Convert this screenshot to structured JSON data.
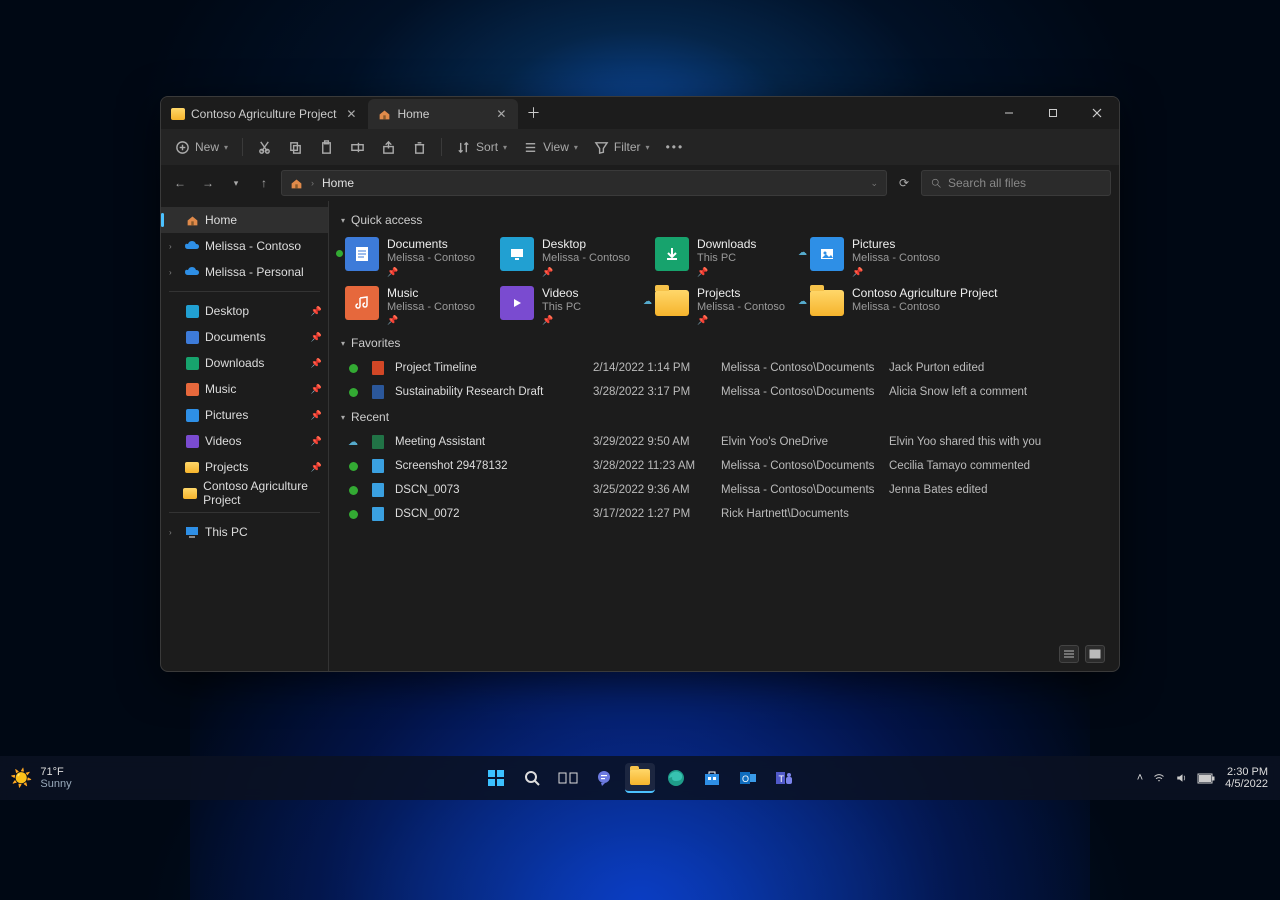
{
  "window": {
    "tabs": [
      {
        "label": "Contoso Agriculture Project",
        "icon": "folder"
      },
      {
        "label": "Home",
        "icon": "home"
      }
    ],
    "active_tab_index": 1
  },
  "toolbar": {
    "new_label": "New",
    "sort_label": "Sort",
    "view_label": "View",
    "filter_label": "Filter"
  },
  "address": {
    "segments": [
      "Home"
    ]
  },
  "search": {
    "placeholder": "Search all files"
  },
  "sidebar": {
    "top": [
      {
        "label": "Home",
        "icon": "home",
        "active": true
      },
      {
        "label": "Melissa - Contoso",
        "icon": "onedrive",
        "expandable": true
      },
      {
        "label": "Melissa - Personal",
        "icon": "onedrive",
        "expandable": true
      }
    ],
    "pinned": [
      {
        "label": "Desktop",
        "icon": "desktop",
        "pinned": true
      },
      {
        "label": "Documents",
        "icon": "documents",
        "pinned": true
      },
      {
        "label": "Downloads",
        "icon": "downloads",
        "pinned": true
      },
      {
        "label": "Music",
        "icon": "music",
        "pinned": true
      },
      {
        "label": "Pictures",
        "icon": "pictures",
        "pinned": true
      },
      {
        "label": "Videos",
        "icon": "videos",
        "pinned": true
      },
      {
        "label": "Projects",
        "icon": "folder-small",
        "pinned": true
      },
      {
        "label": "Contoso Agriculture Project",
        "icon": "folder-small",
        "pinned": false
      }
    ],
    "bottom": [
      {
        "label": "This PC",
        "icon": "pc",
        "expandable": true
      }
    ]
  },
  "sections": {
    "quick_access": {
      "title": "Quick access",
      "items": [
        {
          "name": "Documents",
          "sub": "Melissa - Contoso",
          "icon": "documents-large",
          "color": "#3d7bd9",
          "sync": "green",
          "pinned": true
        },
        {
          "name": "Desktop",
          "sub": "Melissa - Contoso",
          "icon": "desktop-large",
          "color": "#21a0d2",
          "pinned": true
        },
        {
          "name": "Downloads",
          "sub": "This PC",
          "icon": "downloads-large",
          "color": "#17a36d",
          "pinned": true
        },
        {
          "name": "Pictures",
          "sub": "Melissa - Contoso",
          "icon": "pictures-large",
          "color": "#2e8fe6",
          "sync": "cloud",
          "pinned": true
        },
        {
          "name": "Music",
          "sub": "Melissa - Contoso",
          "icon": "music-large",
          "color": "#e6683c",
          "pinned": true
        },
        {
          "name": "Videos",
          "sub": "This PC",
          "icon": "videos-large",
          "color": "#7a4bd0",
          "pinned": true
        },
        {
          "name": "Projects",
          "sub": "Melissa - Contoso",
          "icon": "folder-large",
          "color": "#f6b42c",
          "sync": "cloud",
          "pinned": true
        },
        {
          "name": "Contoso Agriculture Project",
          "sub": "Melissa - Contoso",
          "icon": "folder-large",
          "color": "#f6b42c",
          "sync": "cloud",
          "pinned": false,
          "wide": true
        }
      ]
    },
    "favorites": {
      "title": "Favorites",
      "rows": [
        {
          "name": "Project Timeline",
          "date": "2/14/2022 1:14 PM",
          "location": "Melissa - Contoso\\Documents",
          "activity": "Jack Purton edited",
          "icon": "ppt",
          "sync": "green"
        },
        {
          "name": "Sustainability Research Draft",
          "date": "3/28/2022 3:17 PM",
          "location": "Melissa - Contoso\\Documents",
          "activity": "Alicia Snow left a comment",
          "icon": "word",
          "sync": "green"
        }
      ]
    },
    "recent": {
      "title": "Recent",
      "rows": [
        {
          "name": "Meeting Assistant",
          "date": "3/29/2022 9:50 AM",
          "location": "Elvin Yoo's OneDrive",
          "activity": "Elvin Yoo shared this with you",
          "icon": "xls",
          "sync": "cloud"
        },
        {
          "name": "Screenshot 29478132",
          "date": "3/28/2022 11:23 AM",
          "location": "Melissa - Contoso\\Documents",
          "activity": "Cecilia Tamayo commented",
          "icon": "img",
          "sync": "green"
        },
        {
          "name": "DSCN_0073",
          "date": "3/25/2022 9:36 AM",
          "location": "Melissa - Contoso\\Documents",
          "activity": "Jenna Bates edited",
          "icon": "img",
          "sync": "green"
        },
        {
          "name": "DSCN_0072",
          "date": "3/17/2022 1:27 PM",
          "location": "Rick Hartnett\\Documents",
          "activity": "",
          "icon": "img",
          "sync": "green"
        }
      ]
    }
  },
  "taskbar": {
    "weather": {
      "temp": "71°F",
      "cond": "Sunny"
    },
    "apps": [
      "start",
      "search",
      "taskview",
      "chat",
      "explorer",
      "edge",
      "store",
      "outlook",
      "teams"
    ],
    "active_app": "explorer",
    "time": "2:30 PM",
    "date": "4/5/2022"
  }
}
